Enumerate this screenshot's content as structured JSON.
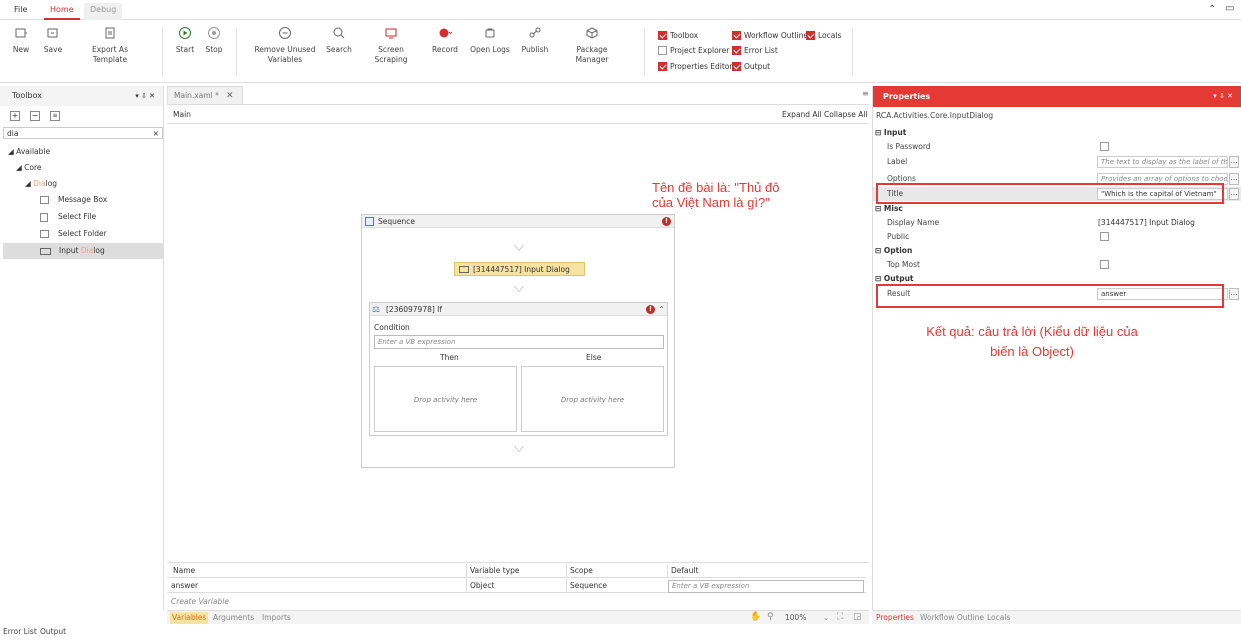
{
  "menu": {
    "file": "File",
    "home": "Home",
    "debug": "Debug"
  },
  "ribbon": {
    "new": "New",
    "save": "Save",
    "export": "Export As Template",
    "start": "Start",
    "stop": "Stop",
    "remove_unused_1": "Remove Unused",
    "remove_unused_2": "Variables",
    "search": "Search",
    "screen_scraping": "Screen Scraping",
    "record": "Record",
    "open_logs": "Open Logs",
    "publish": "Publish",
    "package_manager": "Package Manager",
    "checks": {
      "toolbox": "Toolbox",
      "workflow_outline": "Workflow Outline",
      "locals": "Locals",
      "project_explorer": "Project Explorer",
      "error_list": "Error List",
      "properties_editor": "Properties Editor",
      "output": "Output"
    }
  },
  "toolbox": {
    "title": "Toolbox",
    "controls": "▾ ⇩ ✕",
    "search_value": "dia",
    "clear": "×",
    "available": "Available",
    "core": "Core",
    "dialog_prefix": "",
    "dialog_highlight": "Dia",
    "dialog_suffix": "log",
    "items": [
      "Message Box",
      "Select File",
      "Select Folder"
    ],
    "input_prefix": "Input ",
    "input_highlight": "Dia",
    "input_suffix": "log"
  },
  "designer": {
    "tab": "Main.xaml *",
    "breadcrumb": "Main",
    "expand_all": "Expand All",
    "collapse_all": "Collapse All",
    "sequence": "Sequence",
    "input_dialog": "[314447517] Input Dialog",
    "if_title": "[236097978] If",
    "condition": "Condition",
    "condition_placeholder": "Enter a VB expression",
    "then": "Then",
    "else": "Else",
    "drop": "Drop activity here",
    "err": "!"
  },
  "variables": {
    "headers": [
      "Name",
      "Variable type",
      "Scope",
      "Default"
    ],
    "row": {
      "name": "answer",
      "type": "Object",
      "scope": "Sequence",
      "default": "Enter a VB expression"
    },
    "create": "Create Variable",
    "tabs": {
      "variables": "Variables",
      "arguments": "Arguments",
      "imports": "Imports"
    },
    "zoom": "100%"
  },
  "properties": {
    "title": "Properties",
    "controls": "▾ ⇩ ✕",
    "type": "RCA.Activities.Core.InputDialog",
    "groups": {
      "input": "Input",
      "misc": "Misc",
      "option": "Option",
      "output": "Output"
    },
    "rows": {
      "is_password": "Is Password",
      "label": "Label",
      "label_ph": "The text to display as the label of the",
      "options": "Options",
      "options_ph": "Provides an array of options to choo",
      "title": "Title",
      "title_val": "\"Which is the capital of Vietnam\"",
      "display_name": "Display Name",
      "display_val": "[314447517] Input Dialog",
      "public": "Public",
      "top_most": "Top Most",
      "result": "Result",
      "result_val": "answer"
    },
    "tabs": {
      "properties": "Properties",
      "workflow_outline": "Workflow Outline",
      "locals": "Locals"
    }
  },
  "status": {
    "error_list": "Error List",
    "output": "Output"
  },
  "annotations": {
    "title_note_1": "Tên đề bài là: \"Thủ đô",
    "title_note_2": "của Việt Nam là gì?\"",
    "result_note_1": "Kết quả: câu trả lời (Kiểu dữ liệu của",
    "result_note_2": "biến là Object)"
  },
  "colors": {
    "accent": "#e53935",
    "highlight": "#f7e3a1"
  }
}
